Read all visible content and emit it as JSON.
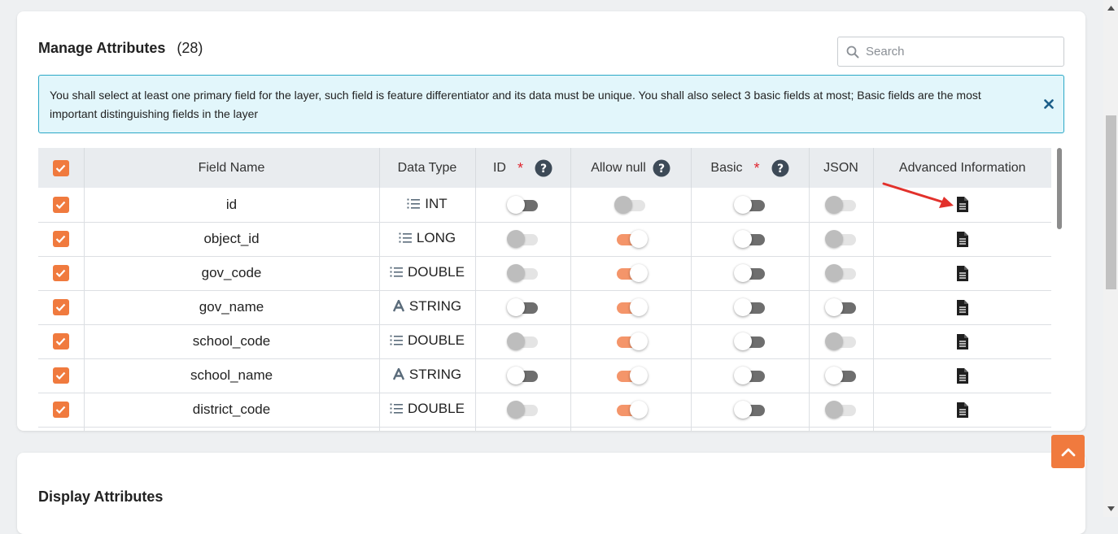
{
  "manage": {
    "title": "Manage Attributes",
    "count": "(28)",
    "search_placeholder": "Search",
    "notice": "You shall select at least one primary field for the layer, such field is feature differentiator and its data must be unique. You shall also select 3 basic fields at most; Basic fields are the most important distinguishing fields in the layer"
  },
  "table": {
    "headers": {
      "field_name": "Field Name",
      "data_type": "Data Type",
      "id": "ID",
      "allow_null": "Allow null",
      "basic": "Basic",
      "json": "JSON",
      "advanced": "Advanced Information"
    },
    "required_mark": "*",
    "rows": [
      {
        "name": "id",
        "type": "INT",
        "type_icon": "list-number-icon",
        "id": "off-dark",
        "allow_null": "off-light",
        "basic": "off-dark",
        "json": "off-light"
      },
      {
        "name": "object_id",
        "type": "LONG",
        "type_icon": "list-number-icon",
        "id": "off-light",
        "allow_null": "on",
        "basic": "off-dark",
        "json": "off-light"
      },
      {
        "name": "gov_code",
        "type": "DOUBLE",
        "type_icon": "list-number-icon",
        "id": "off-light",
        "allow_null": "on",
        "basic": "off-dark",
        "json": "off-light"
      },
      {
        "name": "gov_name",
        "type": "STRING",
        "type_icon": "text-a-icon",
        "id": "off-dark",
        "allow_null": "on",
        "basic": "off-dark",
        "json": "off-dark"
      },
      {
        "name": "school_code",
        "type": "DOUBLE",
        "type_icon": "list-number-icon",
        "id": "off-light",
        "allow_null": "on",
        "basic": "off-dark",
        "json": "off-light"
      },
      {
        "name": "school_name",
        "type": "STRING",
        "type_icon": "text-a-icon",
        "id": "off-dark",
        "allow_null": "on",
        "basic": "off-dark",
        "json": "off-dark"
      },
      {
        "name": "district_code",
        "type": "DOUBLE",
        "type_icon": "list-number-icon",
        "id": "off-light",
        "allow_null": "on",
        "basic": "off-dark",
        "json": "off-light"
      },
      {
        "name": "",
        "type": "",
        "type_icon": "",
        "id": "",
        "allow_null": "",
        "basic": "",
        "json": ""
      }
    ]
  },
  "display": {
    "title": "Display Attributes"
  },
  "colors": {
    "accent": "#f07a3e",
    "notice_bg": "#e2f6fb",
    "notice_border": "#2aa8c6",
    "required": "#e0242e",
    "help_icon": "#3d4a57"
  }
}
